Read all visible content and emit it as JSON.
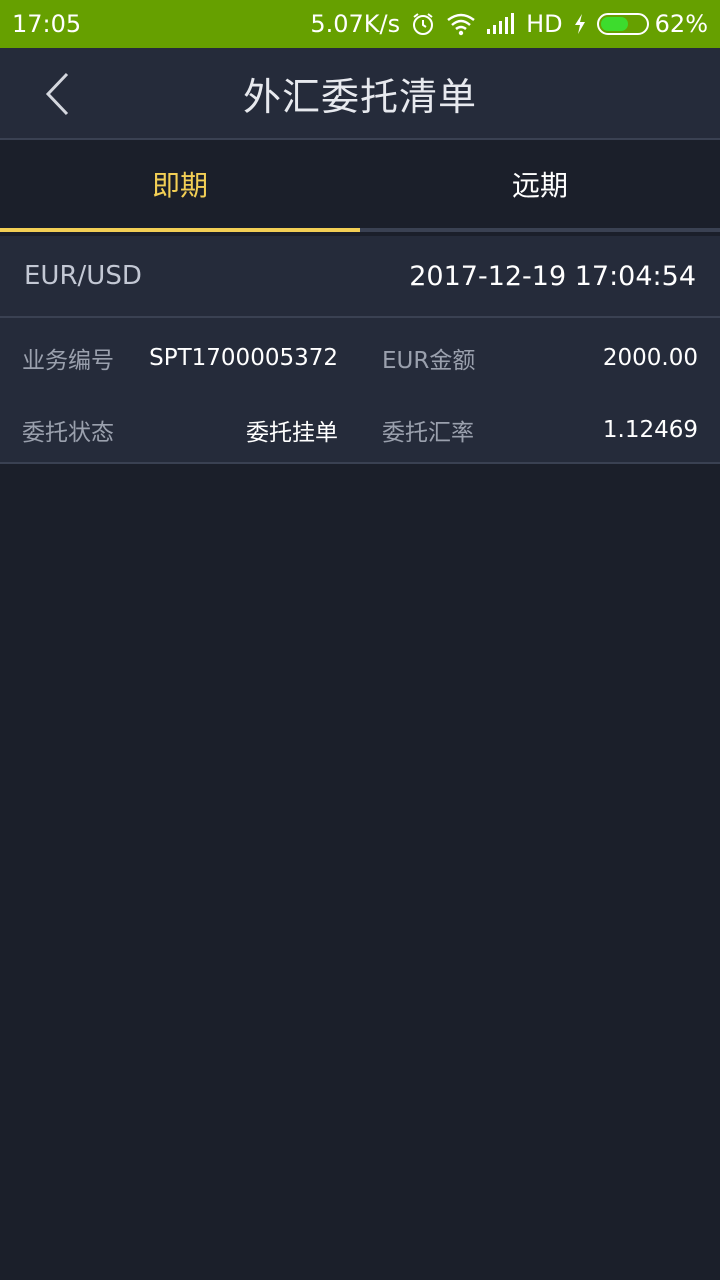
{
  "status_bar": {
    "time": "17:05",
    "net_speed": "5.07K/s",
    "network": "HD",
    "battery": "62%",
    "battery_level": 0.62,
    "icons": [
      "alarm-icon",
      "wifi-icon",
      "signal-icon",
      "charging-icon",
      "battery-icon"
    ]
  },
  "header": {
    "title": "外汇委托清单",
    "back_icon": "chevron-left-icon"
  },
  "tabs": [
    {
      "label": "即期",
      "active": true
    },
    {
      "label": "远期",
      "active": false
    }
  ],
  "order": {
    "pair": "EUR/USD",
    "datetime": "2017-12-19 17:04:54",
    "fields": {
      "business_no_label": "业务编号",
      "business_no": "SPT1700005372",
      "amount_label": "EUR金额",
      "amount": "2000.00",
      "status_label": "委托状态",
      "status": "委托挂单",
      "rate_label": "委托汇率",
      "rate": "1.12469"
    }
  },
  "colors": {
    "status_bar": "#66a000",
    "app_bar": "#252b3a",
    "background": "#1b1f2a",
    "accent": "#f3cf55"
  }
}
